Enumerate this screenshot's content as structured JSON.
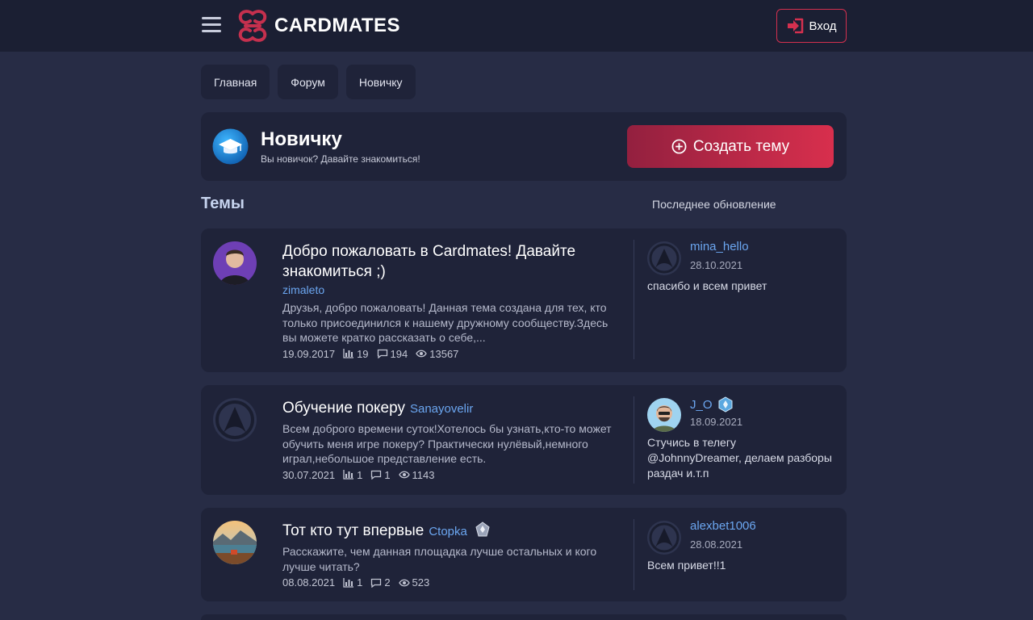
{
  "header": {
    "logo_text": "CARDMATES",
    "login_label": "Вход",
    "accent": "#d4304f"
  },
  "breadcrumbs": [
    {
      "label": "Главная"
    },
    {
      "label": "Форум"
    },
    {
      "label": "Новичку"
    }
  ],
  "forum": {
    "title": "Новичку",
    "subtitle": "Вы новичок? Давайте знакомиться!",
    "icon": "graduation-cap-icon",
    "create_label": "Создать тему"
  },
  "list": {
    "title": "Темы",
    "right_header": "Последнее обновление"
  },
  "topics": [
    {
      "title": "Добро пожаловать в Cardmates! Давайте знакомиться ;)",
      "author": "zimaleto",
      "excerpt": "Друзья, добро пожаловать! Данная тема создана для тех, кто только присоединился к нашему дружному сообществу.Здесь вы можете кратко рассказать о себе,...",
      "date": "19.09.2017",
      "stats": "19",
      "replies": "194",
      "views": "13567",
      "last": {
        "user": "mina_hello",
        "date": "28.10.2021",
        "text": "спасибо и всем привет"
      }
    },
    {
      "title": "Обучение покеру",
      "author": "Sanayovelir",
      "excerpt": "Всем доброго времени суток!Хотелось бы узнать,кто-то может обучить меня игре покеру? Практически нулёвый,немного играл,небольшое представление есть.",
      "date": "30.07.2021",
      "stats": "1",
      "replies": "1",
      "views": "1143",
      "last": {
        "user": "J_O",
        "date": "18.09.2021",
        "text": "Стучись в телегу @JohnnyDreamer, делаем разборы раздач и.т.п"
      }
    },
    {
      "title": "Тот кто тут впервые",
      "author": "Ctopka",
      "excerpt": "Расскажите, чем данная площадка лучше остальных и кого лучше читать?",
      "date": "08.08.2021",
      "stats": "1",
      "replies": "2",
      "views": "523",
      "last": {
        "user": "alexbet1006",
        "date": "28.08.2021",
        "text": "Всем привет!!1"
      }
    }
  ]
}
